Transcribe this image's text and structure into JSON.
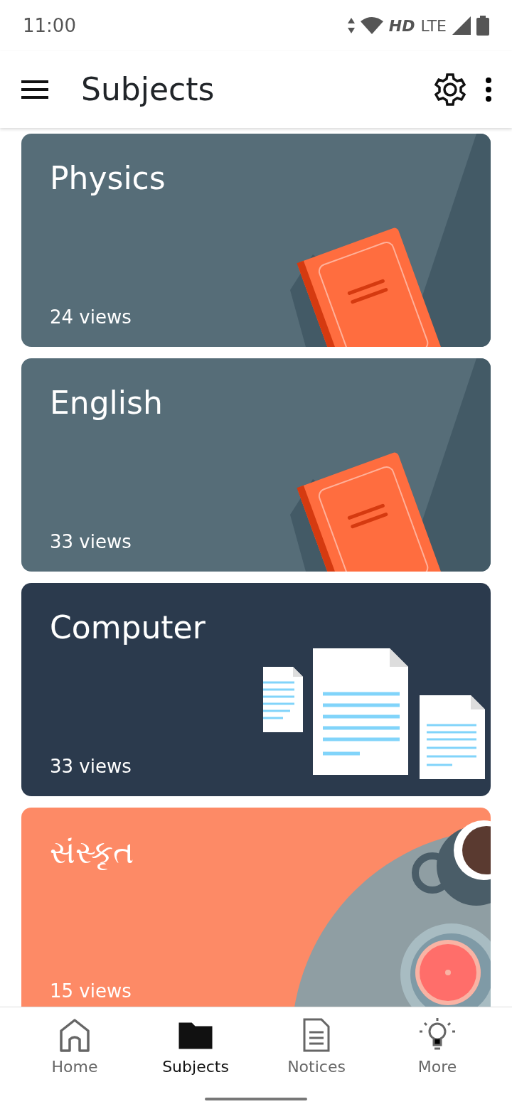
{
  "status_bar": {
    "time": "11:00",
    "hd": "HD",
    "network": "LTE"
  },
  "app_bar": {
    "title": "Subjects"
  },
  "cards": [
    {
      "title": "Physics",
      "views": "24 views",
      "kind": "book",
      "color": "#566d78"
    },
    {
      "title": "English",
      "views": "33 views",
      "kind": "book",
      "color": "#566d78"
    },
    {
      "title": "Computer",
      "views": "33 views",
      "kind": "documents",
      "color": "#2b3a4d"
    },
    {
      "title": "સંસ્કૃત",
      "views": "15 views",
      "kind": "cup",
      "color": "#fd8a66"
    }
  ],
  "bottom_nav": [
    {
      "label": "Home",
      "kind": "home",
      "selected": false
    },
    {
      "label": "Subjects",
      "kind": "folder",
      "selected": true
    },
    {
      "label": "Notices",
      "kind": "document",
      "selected": false
    },
    {
      "label": "More",
      "kind": "bulb",
      "selected": false
    }
  ]
}
